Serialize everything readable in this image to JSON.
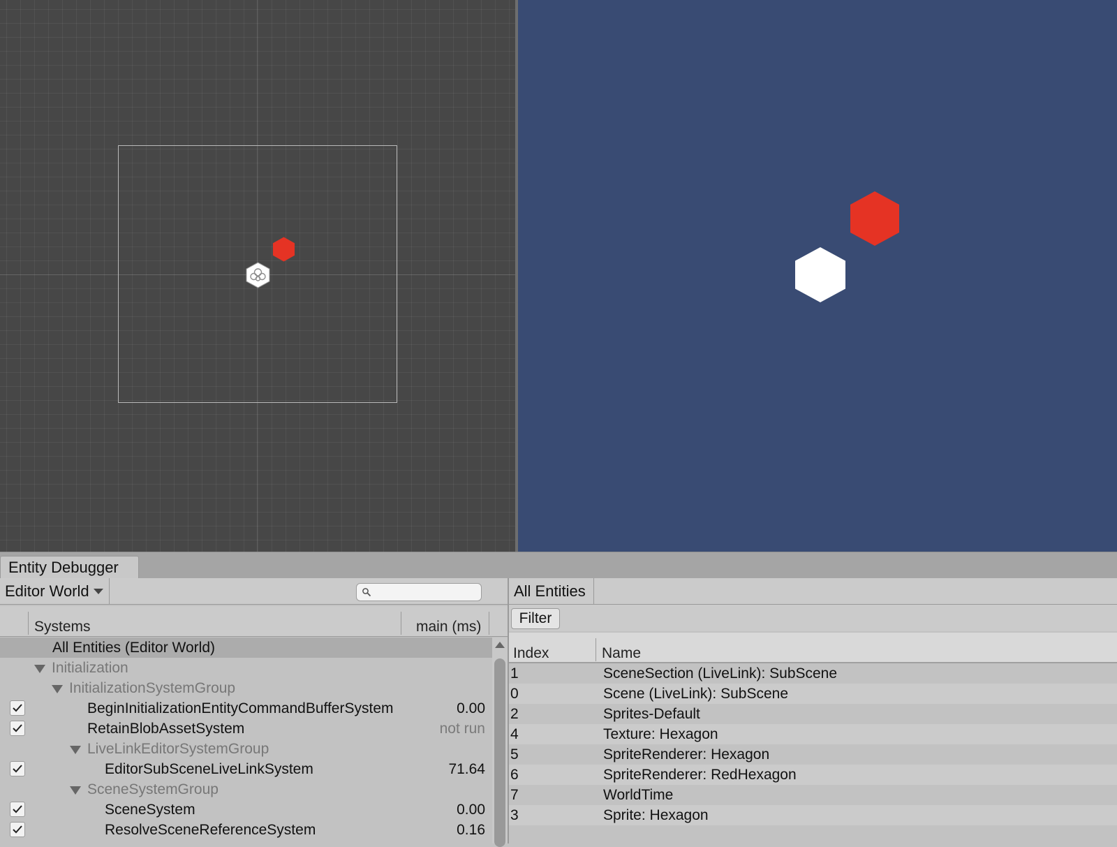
{
  "colors": {
    "scene_background": "#474747",
    "game_background": "#394b73",
    "hexagon_white": "#ffffff",
    "hexagon_red": "#e53324"
  },
  "scene_view": {
    "objects": [
      {
        "name": "hexagon",
        "color": "#ffffff",
        "selected": true
      },
      {
        "name": "red-hexagon",
        "color": "#e53324",
        "selected": false
      }
    ]
  },
  "game_view": {
    "objects": [
      {
        "name": "hexagon",
        "color": "#ffffff"
      },
      {
        "name": "red-hexagon",
        "color": "#e53324"
      }
    ]
  },
  "debugger": {
    "tab_title": "Entity Debugger",
    "world_dropdown": "Editor World",
    "search": {
      "value": "",
      "placeholder": ""
    },
    "systems_header": {
      "systems": "Systems",
      "main": "main (ms)"
    },
    "systems": [
      {
        "label": "All Entities (Editor World)",
        "value": "",
        "kind": "item",
        "depth": 0,
        "selected": true,
        "checkbox": false
      },
      {
        "label": "Initialization",
        "value": "",
        "kind": "group",
        "depth": 0,
        "checkbox": false
      },
      {
        "label": "InitializationSystemGroup",
        "value": "",
        "kind": "group",
        "depth": 1,
        "checkbox": false
      },
      {
        "label": "BeginInitializationEntityCommandBufferSystem",
        "value": "0.00",
        "kind": "item",
        "depth": 2,
        "checkbox": true
      },
      {
        "label": "RetainBlobAssetSystem",
        "value": "not run",
        "kind": "item",
        "depth": 2,
        "checkbox": true
      },
      {
        "label": "LiveLinkEditorSystemGroup",
        "value": "",
        "kind": "group",
        "depth": 2,
        "checkbox": false
      },
      {
        "label": "EditorSubSceneLiveLinkSystem",
        "value": "71.64",
        "kind": "item",
        "depth": 3,
        "checkbox": true
      },
      {
        "label": "SceneSystemGroup",
        "value": "",
        "kind": "group",
        "depth": 2,
        "checkbox": false
      },
      {
        "label": "SceneSystem",
        "value": "0.00",
        "kind": "item",
        "depth": 3,
        "checkbox": true
      },
      {
        "label": "ResolveSceneReferenceSystem",
        "value": "0.16",
        "kind": "item",
        "depth": 3,
        "checkbox": true
      }
    ],
    "entities_panel": {
      "title": "All Entities",
      "filter_label": "Filter",
      "columns": {
        "index": "Index",
        "name": "Name"
      },
      "rows": [
        {
          "index": "1",
          "name": "SceneSection (LiveLink): SubScene"
        },
        {
          "index": "0",
          "name": "Scene (LiveLink): SubScene"
        },
        {
          "index": "2",
          "name": "Sprites-Default"
        },
        {
          "index": "4",
          "name": "Texture: Hexagon"
        },
        {
          "index": "5",
          "name": "SpriteRenderer: Hexagon"
        },
        {
          "index": "6",
          "name": "SpriteRenderer: RedHexagon"
        },
        {
          "index": "7",
          "name": "WorldTime"
        },
        {
          "index": "3",
          "name": "Sprite: Hexagon"
        }
      ]
    }
  }
}
